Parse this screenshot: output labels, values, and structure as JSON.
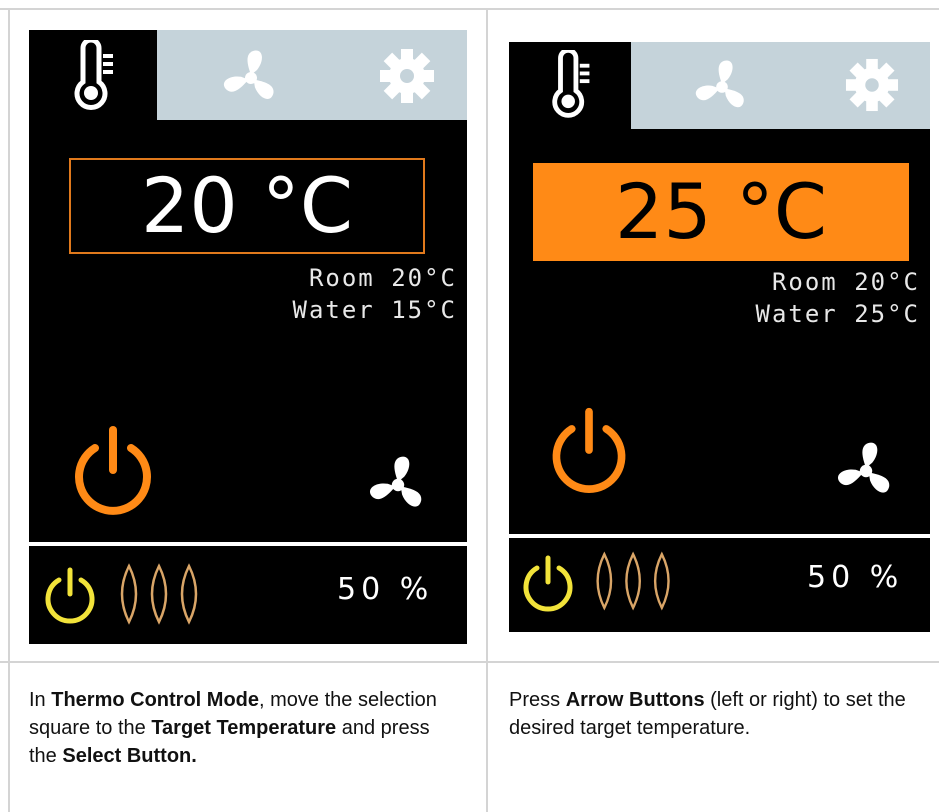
{
  "panels": [
    {
      "tabs": [
        {
          "icon": "thermometer-icon",
          "active": true
        },
        {
          "icon": "fan-icon",
          "active": false
        },
        {
          "icon": "gear-icon",
          "active": false
        }
      ],
      "target_temp": "20 °C",
      "room": "Room 20°C",
      "water": "Water 15°C",
      "percent": "50 %",
      "selection_style": "outline"
    },
    {
      "tabs": [
        {
          "icon": "thermometer-icon",
          "active": true
        },
        {
          "icon": "fan-icon",
          "active": false
        },
        {
          "icon": "gear-icon",
          "active": false
        }
      ],
      "target_temp": "25 °C",
      "room": "Room 20°C",
      "water": "Water 25°C",
      "percent": "50 %",
      "selection_style": "filled"
    }
  ],
  "captions": [
    {
      "parts": [
        {
          "text": "In ",
          "bold": false
        },
        {
          "text": "Thermo Control Mode",
          "bold": true
        },
        {
          "text": ", move the selection square to the ",
          "bold": false
        },
        {
          "text": "Target Temperature",
          "bold": true
        },
        {
          "text": " and press the ",
          "bold": false
        },
        {
          "text": "Select Button.",
          "bold": true
        }
      ]
    },
    {
      "parts": [
        {
          "text": "Press ",
          "bold": false
        },
        {
          "text": "Arrow Buttons",
          "bold": true
        },
        {
          "text": " (left or right) to set the desired target temperature.",
          "bold": false
        }
      ]
    }
  ],
  "colors": {
    "accent_orange": "#ff8a16",
    "outline_orange": "#e0791c",
    "power_yellow": "#f2e33a",
    "heat_tan": "#d9a567",
    "tab_inactive_bg": "#c5d3da"
  }
}
